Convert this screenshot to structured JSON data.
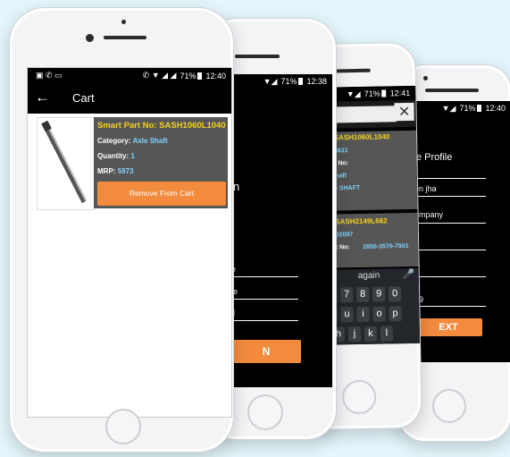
{
  "phone1": {
    "status": {
      "signal": "LTE",
      "battery": "71%",
      "time": "12:40"
    },
    "title": "Cart",
    "item": {
      "part_label": "Smart Part No:",
      "part_value": "SASH1060L1040",
      "category_label": "Category:",
      "category_value": "Axle Shaft",
      "quantity_label": "Quantity:",
      "quantity_value": "1",
      "mrp_label": "MRP:",
      "mrp_value": "5973",
      "remove_label": "Remove From Cart"
    }
  },
  "phone2": {
    "status": {
      "battery": "71%",
      "time": "12:38"
    },
    "heading": "n",
    "fields": [
      "e",
      "le",
      "il"
    ],
    "button_label": "N"
  },
  "phone3": {
    "status": {
      "battery": "71%",
      "time": "12:41"
    },
    "close_glyph": "✕",
    "card1": {
      "part_line": "No:  SASH1060L1040",
      "code": "993631",
      "part_label": "t Part No:",
      "category": "xle Shaft",
      "desc": "Axle SHAFT"
    },
    "card2": {
      "part_line": "No:  SASH2149L682",
      "code": "2002097",
      "part_label": "t Part No:",
      "part_value": "2850-3570-7901"
    },
    "keyboard": {
      "suggestions": [
        "d",
        "again"
      ],
      "row1": [
        "6",
        "7",
        "8",
        "9",
        "0"
      ],
      "row2": [
        "y",
        "u",
        "i",
        "o",
        "p"
      ],
      "row3": [
        "h",
        "j",
        "k",
        "l"
      ]
    }
  },
  "phone4": {
    "status": {
      "battery": "71%",
      "time": "12:40"
    },
    "title": "e Profile",
    "fields": [
      "en jha",
      "ompany",
      "",
      "",
      "59"
    ],
    "button_label": "EXT"
  },
  "colors": {
    "accent": "#f28b3e",
    "yellow": "#f4d21f",
    "blue": "#7fd4ff"
  }
}
